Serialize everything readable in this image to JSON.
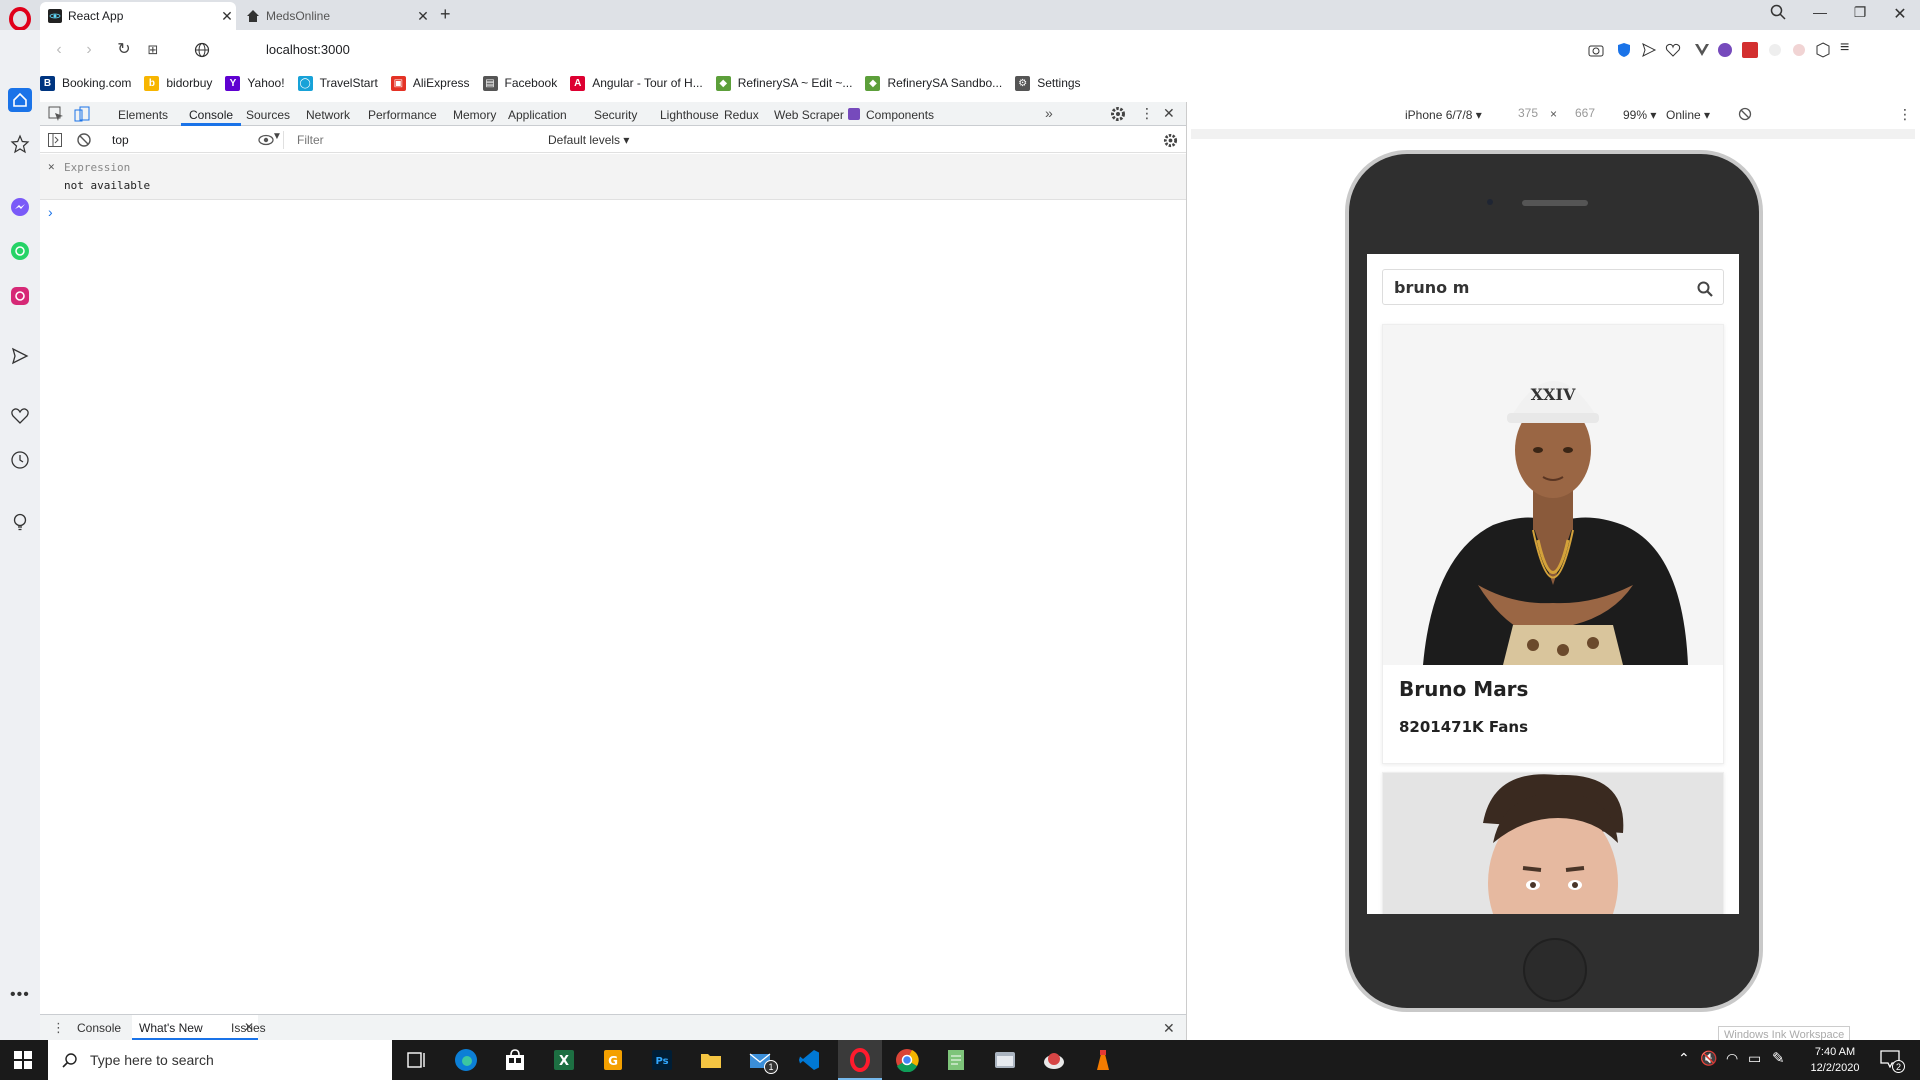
{
  "tabs": [
    {
      "title": "React App",
      "active": true
    },
    {
      "title": "MedsOnline",
      "active": false
    }
  ],
  "address": {
    "url": "localhost:3000"
  },
  "bookmarks": [
    {
      "label": "Booking.com",
      "color": "#003580",
      "glyph": "B"
    },
    {
      "label": "bidorbuy",
      "color": "#f7b500",
      "glyph": "b"
    },
    {
      "label": "Yahoo!",
      "color": "#5f01d1",
      "glyph": "Y"
    },
    {
      "label": "TravelStart",
      "color": "#17a2d8",
      "glyph": "◯"
    },
    {
      "label": "AliExpress",
      "color": "#e43225",
      "glyph": "▣"
    },
    {
      "label": "Facebook",
      "color": "#555555",
      "glyph": "▤"
    },
    {
      "label": "Angular - Tour of H...",
      "color": "#dd0031",
      "glyph": "A"
    },
    {
      "label": "RefinerySA ~ Edit ~...",
      "color": "#5c9f3a",
      "glyph": "◆"
    },
    {
      "label": "RefinerySA Sandbo...",
      "color": "#5c9f3a",
      "glyph": "◆"
    },
    {
      "label": "Settings",
      "color": "#555555",
      "glyph": "⚙"
    }
  ],
  "devtools": {
    "tabs": [
      "Elements",
      "Console",
      "Sources",
      "Network",
      "Performance",
      "Memory",
      "Application",
      "Security",
      "Lighthouse",
      "Redux",
      "Web Scraper",
      "Components"
    ],
    "active_tab": "Console",
    "context": "top",
    "filter_placeholder": "Filter",
    "levels": "Default levels ▾",
    "expression_label": "Expression",
    "expression_value": "not available",
    "prompt": "›",
    "drawer_tabs": [
      "Console",
      "What's New",
      "Issues"
    ],
    "drawer_active": "What's New"
  },
  "device": {
    "model": "iPhone 6/7/8 ▾",
    "width": "375",
    "times": "×",
    "height": "667",
    "zoom": "99% ▾",
    "network": "Online ▾"
  },
  "app": {
    "search_value": "bruno m",
    "results": [
      {
        "name": "Bruno Mars",
        "fans": "8201471K Fans"
      }
    ]
  },
  "ink_tooltip": "Windows Ink Workspace",
  "taskbar": {
    "search_placeholder": "Type here to search",
    "time": "7:40 AM",
    "date": "12/2/2020",
    "mail_badge": "1",
    "notif_badge": "2"
  }
}
